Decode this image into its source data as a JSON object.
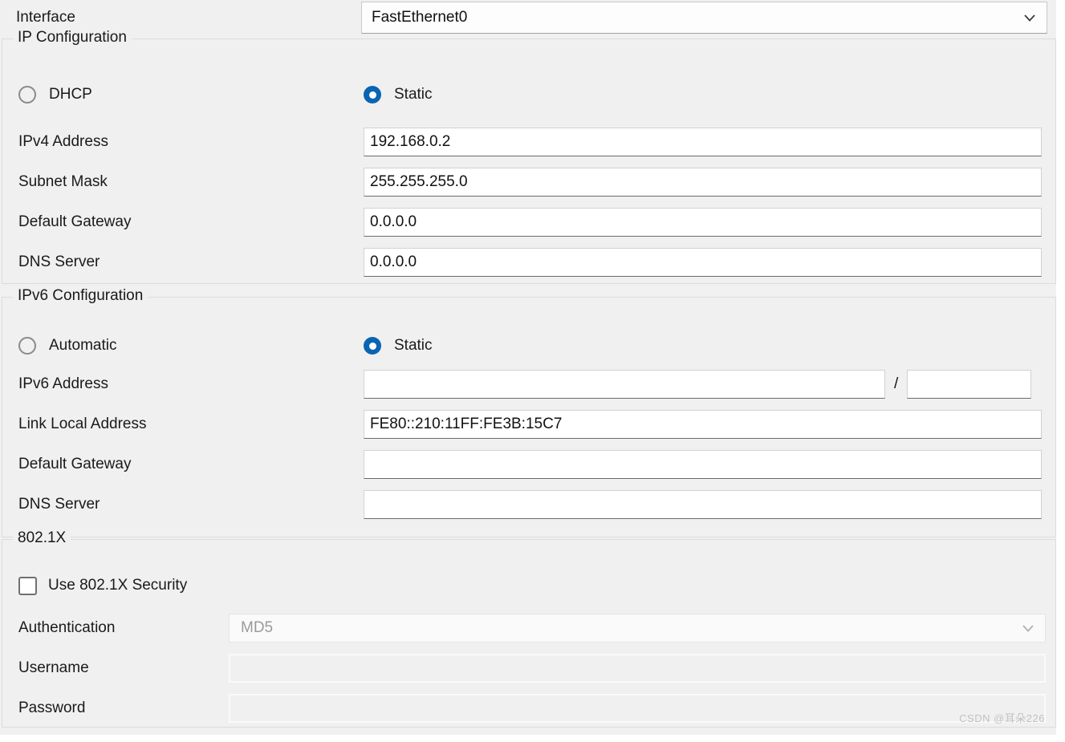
{
  "interface": {
    "label": "Interface",
    "value": "FastEthernet0",
    "chevron": "chevron-down-icon"
  },
  "ip_configuration": {
    "title": "IP Configuration",
    "mode": {
      "dhcp_label": "DHCP",
      "dhcp_selected": false,
      "static_label": "Static",
      "static_selected": true
    },
    "fields": {
      "ipv4_address_label": "IPv4 Address",
      "ipv4_address_value": "192.168.0.2",
      "subnet_mask_label": "Subnet Mask",
      "subnet_mask_value": "255.255.255.0",
      "default_gateway_label": "Default Gateway",
      "default_gateway_value": "0.0.0.0",
      "dns_server_label": "DNS Server",
      "dns_server_value": "0.0.0.0"
    }
  },
  "ipv6_configuration": {
    "title": "IPv6 Configuration",
    "mode": {
      "automatic_label": "Automatic",
      "automatic_selected": false,
      "static_label": "Static",
      "static_selected": true
    },
    "fields": {
      "ipv6_address_label": "IPv6 Address",
      "ipv6_address_value": "",
      "prefix_separator": "/",
      "prefix_value": "",
      "link_local_label": "Link Local Address",
      "link_local_value": "FE80::210:11FF:FE3B:15C7",
      "default_gateway_label": "Default Gateway",
      "default_gateway_value": "",
      "dns_server_label": "DNS Server",
      "dns_server_value": ""
    }
  },
  "dot1x": {
    "title": "802.1X",
    "use_security_label": "Use 802.1X Security",
    "use_security_checked": false,
    "authentication_label": "Authentication",
    "authentication_value": "MD5",
    "username_label": "Username",
    "username_value": "",
    "password_label": "Password",
    "password_value": ""
  },
  "watermark": "CSDN @耳朵226",
  "colors": {
    "accent": "#0a64b4",
    "panel": "#f0f0f0",
    "field": "#ffffff",
    "text": "#1a1a1a",
    "disabled_text": "#9a9a9a"
  }
}
